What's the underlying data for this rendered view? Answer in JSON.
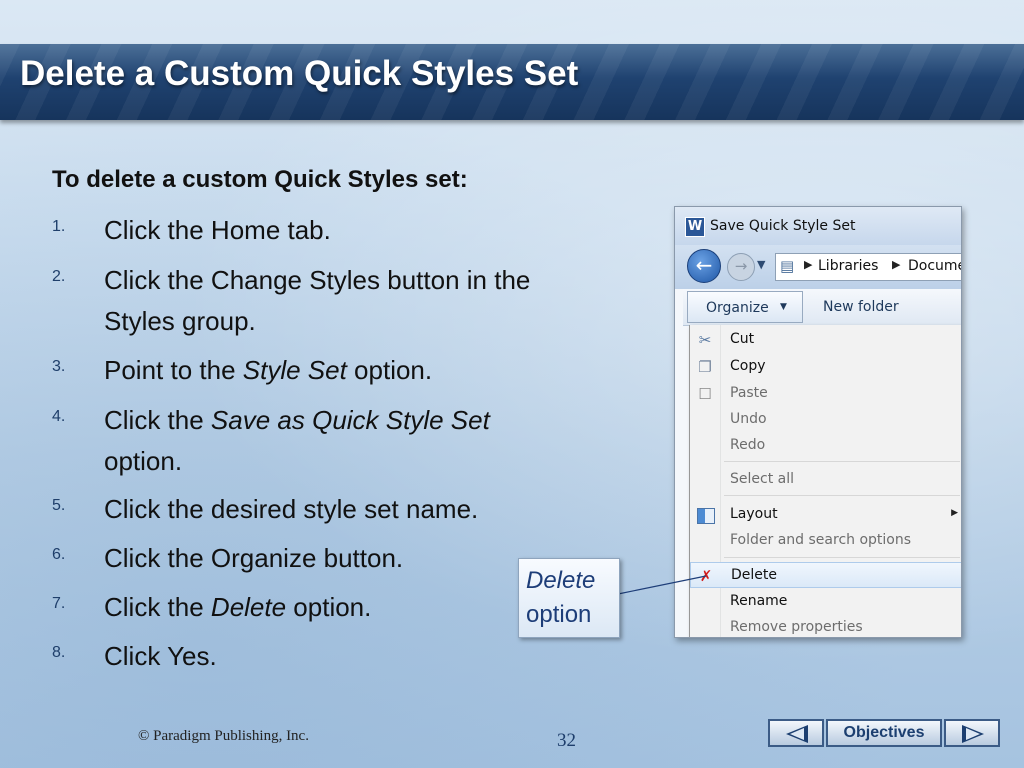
{
  "slide": {
    "title": "Delete a Custom Quick Styles Set",
    "intro": "To delete a custom Quick Styles set:",
    "steps": [
      {
        "num": "1.",
        "pre": "Click the Home tab.",
        "em": "",
        "post": ""
      },
      {
        "num": "2.",
        "pre": "Click the Change Styles button in the Styles group.",
        "em": "",
        "post": ""
      },
      {
        "num": "3.",
        "pre": "Point to the ",
        "em": "Style Set",
        "post": " option."
      },
      {
        "num": "4.",
        "pre": "Click the ",
        "em": "Save as Quick Style Set",
        "post": " option."
      },
      {
        "num": "5.",
        "pre": "Click the desired style set name.",
        "em": "",
        "post": ""
      },
      {
        "num": "6.",
        "pre": "Click the Organize button.",
        "em": "",
        "post": ""
      },
      {
        "num": "7.",
        "pre": "Click the ",
        "em": "Delete",
        "post": " option."
      },
      {
        "num": "8.",
        "pre": "Click Yes.",
        "em": "",
        "post": ""
      }
    ]
  },
  "dialog": {
    "app_icon_letter": "W",
    "title": "Save Quick Style Set",
    "address": {
      "crumb1": "Libraries",
      "crumb2": "Documents"
    },
    "toolbar": {
      "organize": "Organize",
      "new_folder": "New folder"
    },
    "menu": [
      {
        "label": "Cut",
        "icon": "scissors-icon",
        "disabled": false
      },
      {
        "label": "Copy",
        "icon": "copy-icon",
        "disabled": false
      },
      {
        "label": "Paste",
        "icon": "paste-icon",
        "disabled": true
      },
      {
        "label": "Undo",
        "icon": "",
        "disabled": true
      },
      {
        "label": "Redo",
        "icon": "",
        "disabled": true
      },
      {
        "label": "Select all",
        "icon": "",
        "disabled": true
      },
      {
        "label": "Layout",
        "icon": "layout-icon",
        "disabled": false,
        "submenu": true
      },
      {
        "label": "Folder and search options",
        "icon": "",
        "disabled": true
      },
      {
        "label": "Delete",
        "icon": "delete-x-icon",
        "disabled": false,
        "highlighted": true
      },
      {
        "label": "Rename",
        "icon": "",
        "disabled": false
      },
      {
        "label": "Remove properties",
        "icon": "",
        "disabled": true
      }
    ]
  },
  "callout": {
    "line1": "Delete",
    "line2": "option"
  },
  "footer": {
    "copyright": "© Paradigm Publishing, Inc.",
    "page": "32",
    "objectives": "Objectives"
  },
  "colors": {
    "title_bar": "#1f4270",
    "callout_text": "#1d3d78",
    "delete_icon": "#d21a1a"
  }
}
